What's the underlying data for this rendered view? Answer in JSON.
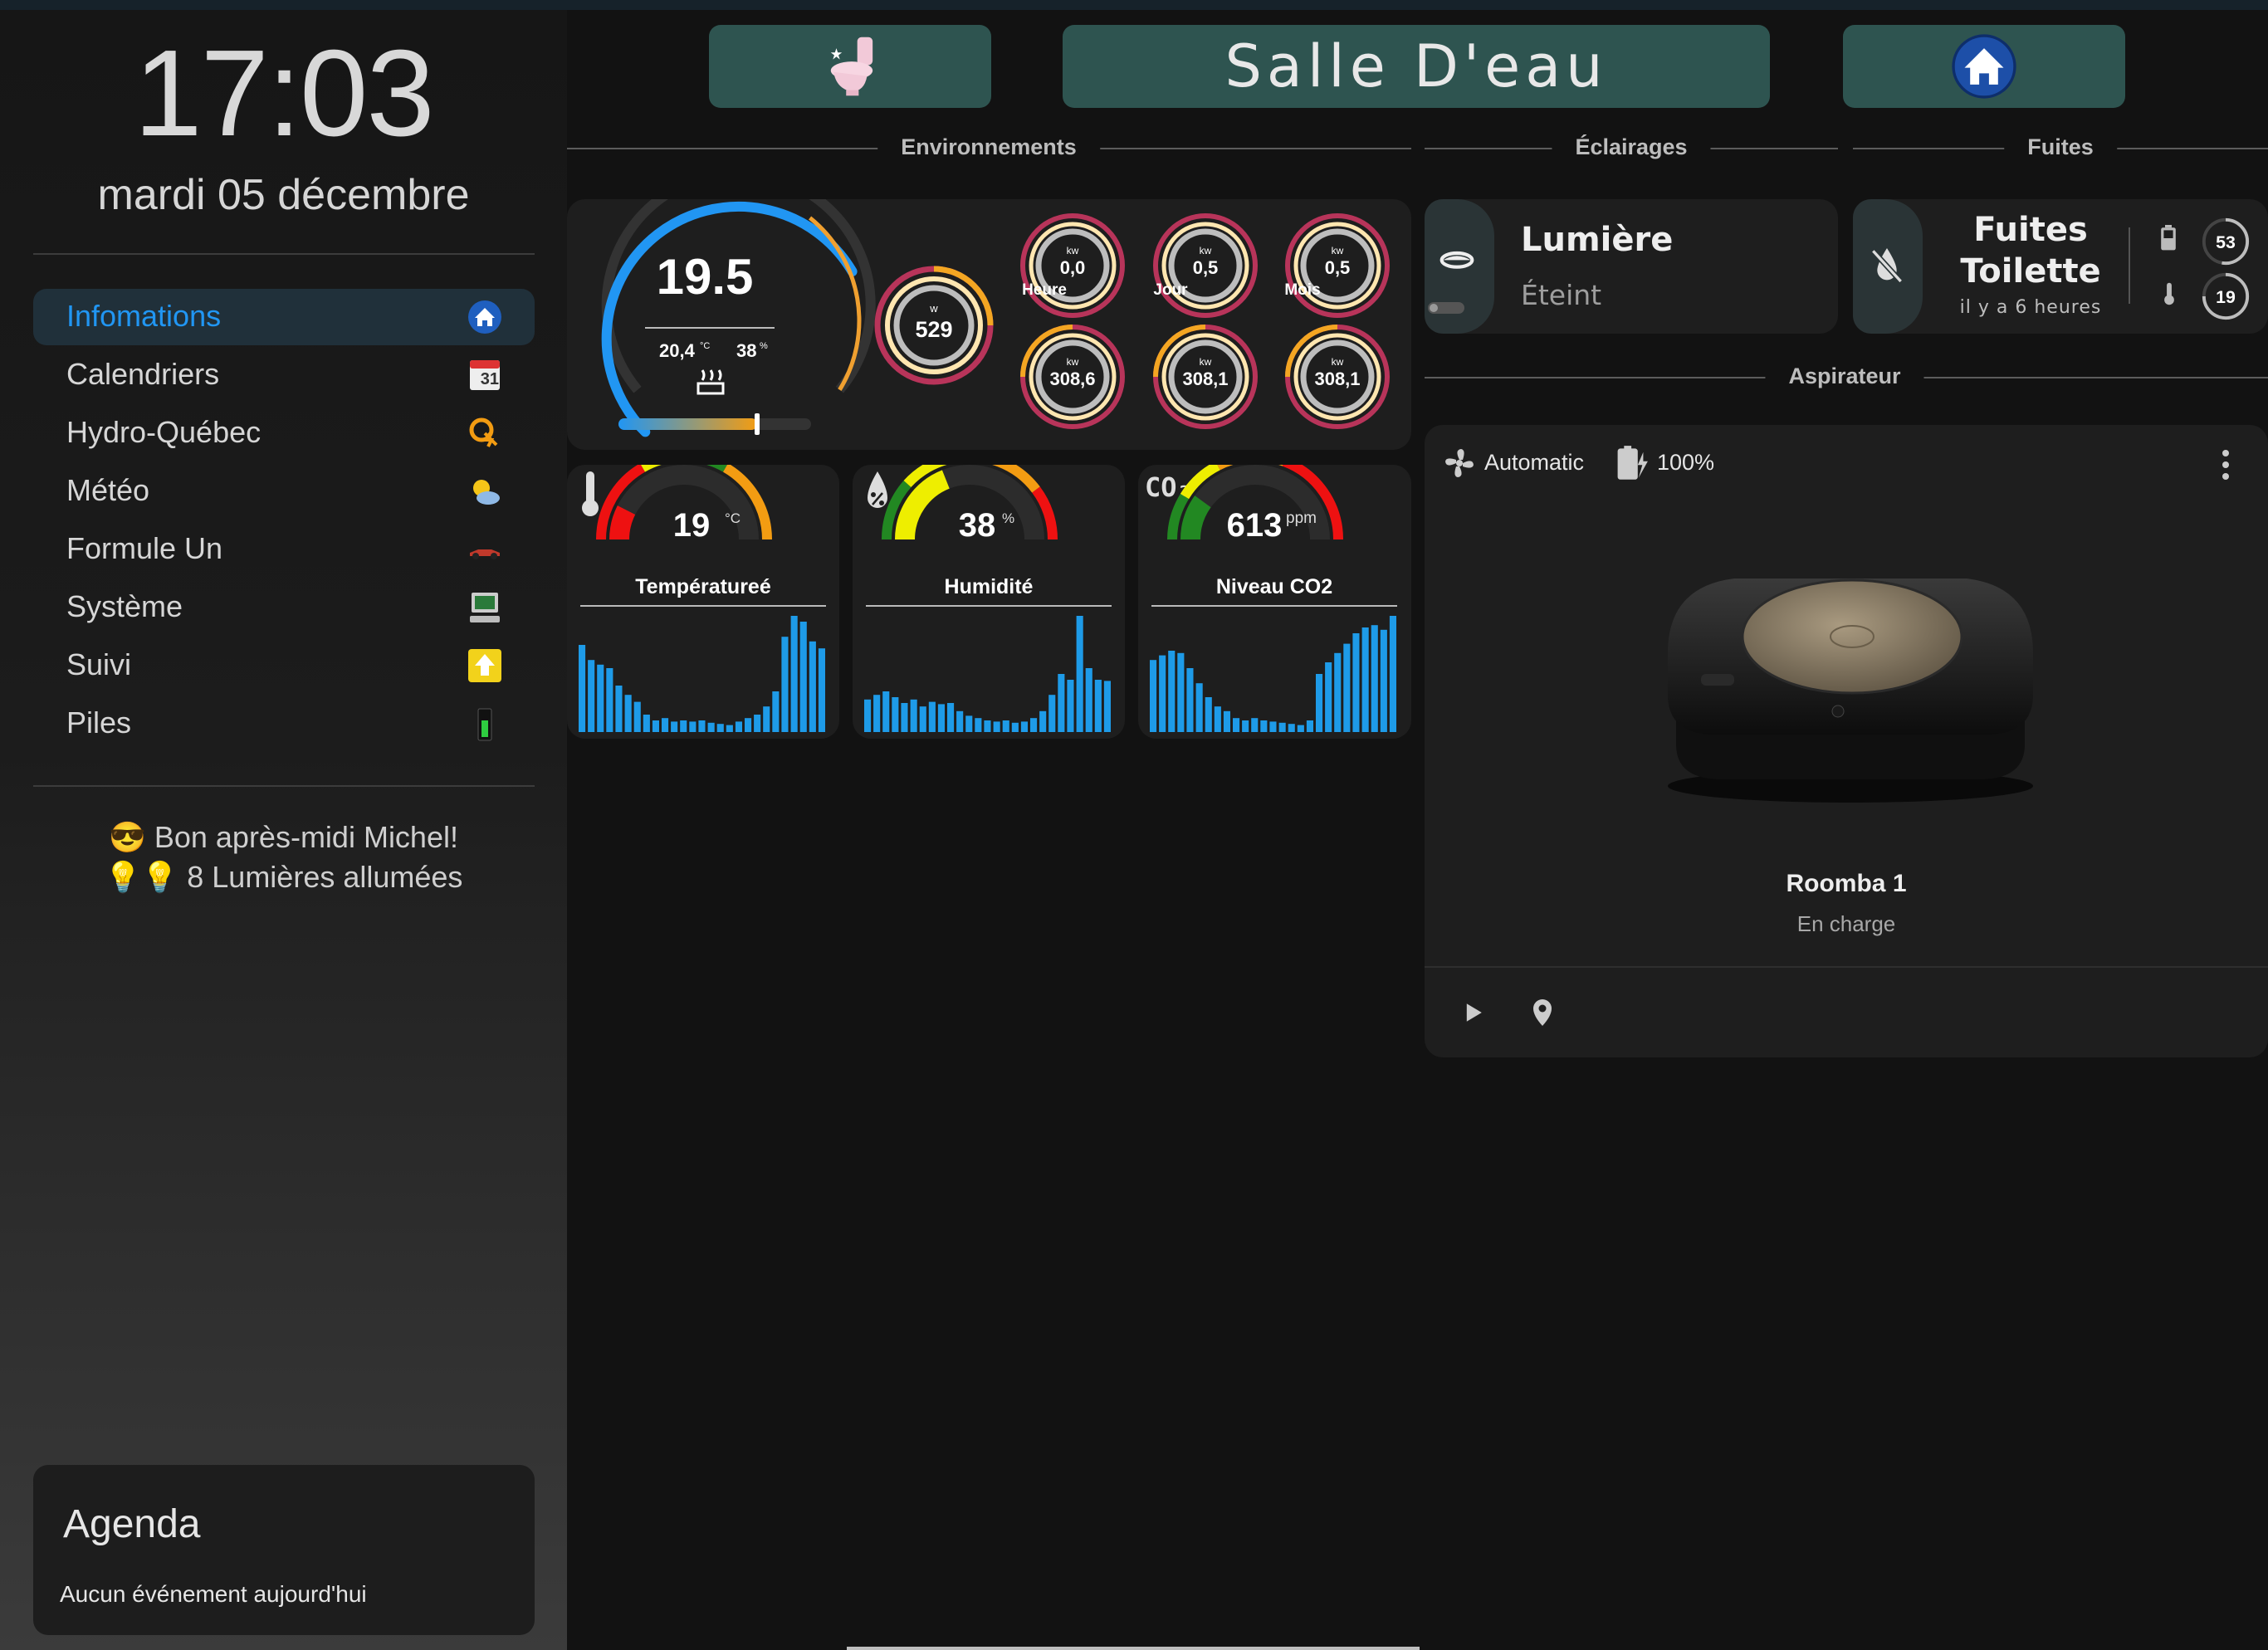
{
  "sidebar": {
    "time": "17:03",
    "date": "mardi 05 décembre",
    "items": [
      {
        "label": "Infomations",
        "icon": "home-icon",
        "active": true
      },
      {
        "label": "Calendriers",
        "icon": "calendar-icon"
      },
      {
        "label": "Hydro-Québec",
        "icon": "hydro-quebec-icon"
      },
      {
        "label": "Météo",
        "icon": "weather-icon"
      },
      {
        "label": "Formule Un",
        "icon": "f1-car-icon"
      },
      {
        "label": "Système",
        "icon": "computer-icon"
      },
      {
        "label": "Suivi",
        "icon": "arrow-up-icon"
      },
      {
        "label": "Piles",
        "icon": "battery-icon"
      }
    ],
    "calendar_day": "31",
    "greeting_line1": "Bon après-midi Michel!",
    "greeting_line2": "8 Lumières allumées",
    "agenda_title": "Agenda",
    "agenda_empty": "Aucun événement aujourd'hui"
  },
  "header": {
    "room_title": "Salle D'eau",
    "left_icon": "toilet-icon",
    "right_icon": "home-icon"
  },
  "sections": {
    "environnements": "Environnements",
    "eclairages": "Éclairages",
    "fuites": "Fuites",
    "aspirateur": "Aspirateur"
  },
  "thermostat": {
    "target": "19.5",
    "current_temp": "20,4",
    "temp_unit": "°C",
    "humidity": "38",
    "humidity_unit": "%",
    "mode_icon": "heat-icon",
    "level": 0.72
  },
  "power": {
    "unit": "w",
    "value": "529"
  },
  "energy": [
    {
      "label": "Heure",
      "top_unit": "kw",
      "top_value": "0,0",
      "bottom_unit": "kw",
      "bottom_value": "308,6"
    },
    {
      "label": "Jour",
      "top_unit": "kw",
      "top_value": "0,5",
      "bottom_unit": "kw",
      "bottom_value": "308,1"
    },
    {
      "label": "Mois",
      "top_unit": "kw",
      "top_value": "0,5",
      "bottom_unit": "kw",
      "bottom_value": "308,1"
    }
  ],
  "gauges": [
    {
      "name": "Températureé",
      "value": "19",
      "unit": "°C",
      "icon": "thermometer-icon",
      "level": 0.15,
      "scheme": "temp"
    },
    {
      "name": "Humidité",
      "value": "38",
      "unit": "%",
      "icon": "humidity-icon",
      "level": 0.38,
      "scheme": "hum"
    },
    {
      "name": "Niveau CO2",
      "value": "613",
      "unit": "ppm",
      "icon": "co2-icon",
      "level": 0.2,
      "scheme": "co2"
    }
  ],
  "histories": [
    [
      0.75,
      0.62,
      0.58,
      0.55,
      0.4,
      0.32,
      0.26,
      0.15,
      0.1,
      0.12,
      0.09,
      0.1,
      0.09,
      0.1,
      0.08,
      0.07,
      0.06,
      0.09,
      0.12,
      0.15,
      0.22,
      0.35,
      0.82,
      1.0,
      0.95,
      0.78,
      0.72
    ],
    [
      0.28,
      0.32,
      0.35,
      0.3,
      0.25,
      0.28,
      0.22,
      0.26,
      0.24,
      0.25,
      0.18,
      0.14,
      0.12,
      0.1,
      0.09,
      0.1,
      0.08,
      0.09,
      0.12,
      0.18,
      0.32,
      0.5,
      0.45,
      1.0,
      0.55,
      0.45,
      0.44
    ],
    [
      0.62,
      0.66,
      0.7,
      0.68,
      0.55,
      0.42,
      0.3,
      0.22,
      0.18,
      0.12,
      0.1,
      0.12,
      0.1,
      0.09,
      0.08,
      0.07,
      0.06,
      0.1,
      0.5,
      0.6,
      0.68,
      0.76,
      0.85,
      0.9,
      0.92,
      0.88,
      1.0
    ]
  ],
  "light": {
    "name": "Lumière",
    "state": "Éteint",
    "icon": "ceiling-light-icon"
  },
  "leak": {
    "title_line1": "Fuites",
    "title_line2": "Toilette",
    "time": "il y a 6 heures",
    "icon": "water-off-icon",
    "battery": "53",
    "temperature": "19"
  },
  "vacuum": {
    "fan_mode": "Automatic",
    "battery": "100%",
    "name": "Roomba 1",
    "status": "En charge"
  },
  "colors": {
    "accent": "#2196f3",
    "button_bg": "#2e5450",
    "ring_orange": "#f4a622",
    "ring_pink": "#b8345a",
    "bar_blue": "#1e9be8"
  }
}
